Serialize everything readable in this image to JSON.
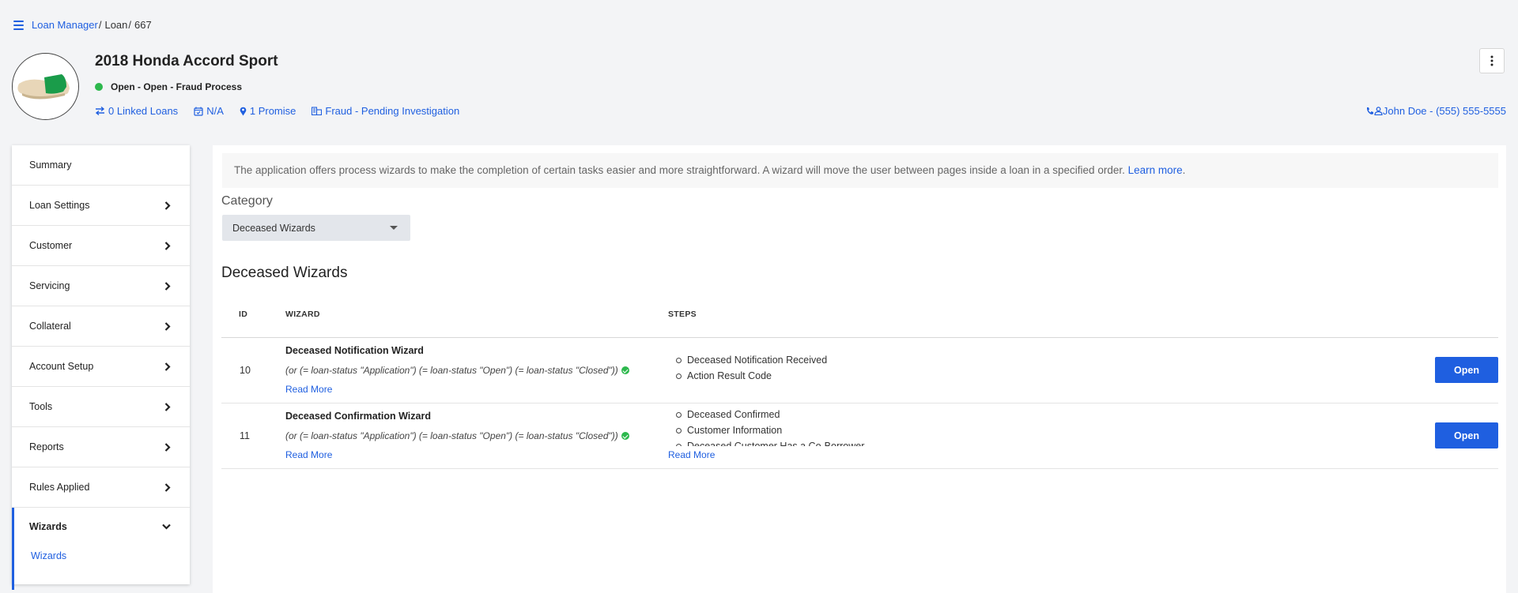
{
  "breadcrumb": {
    "items": [
      "Loan Manager",
      "Loan",
      "667"
    ],
    "separator": "/"
  },
  "header": {
    "title": "2018 Honda Accord Sport",
    "status": "Open - Open - Fraud Process",
    "status_color": "#2db84d",
    "linked_loans": "0 Linked Loans",
    "date": "N/A",
    "promise": "1 Promise",
    "portfolio": "Fraud - Pending Investigation",
    "contact": "John Doe - (555) 555-5555"
  },
  "sidebar": {
    "items": [
      {
        "label": "Summary",
        "chevron": false
      },
      {
        "label": "Loan Settings",
        "chevron": true
      },
      {
        "label": "Customer",
        "chevron": true
      },
      {
        "label": "Servicing",
        "chevron": true
      },
      {
        "label": "Collateral",
        "chevron": true
      },
      {
        "label": "Account Setup",
        "chevron": true
      },
      {
        "label": "Tools",
        "chevron": true
      },
      {
        "label": "Reports",
        "chevron": true
      },
      {
        "label": "Rules Applied",
        "chevron": true
      }
    ],
    "active": {
      "label": "Wizards",
      "sub": "Wizards"
    }
  },
  "main": {
    "info_text": "The application offers process wizards to make the completion of certain tasks easier and more straightforward. A wizard will move the user between pages inside a loan in a specified order.",
    "learn_more": "Learn more",
    "category_label": "Category",
    "category_value": "Deceased Wizards",
    "section_title": "Deceased Wizards",
    "columns": [
      "ID",
      "WIZARD",
      "STEPS"
    ],
    "rows": [
      {
        "id": "10",
        "name": "Deceased Notification Wizard",
        "condition": "(or (= loan-status \"Application\") (= loan-status \"Open\") (= loan-status \"Closed\"))",
        "read_more": "Read More",
        "steps": [
          "Deceased Notification Received",
          "Action Result Code"
        ],
        "steps_read_more": "",
        "button": "Open"
      },
      {
        "id": "11",
        "name": "Deceased Confirmation Wizard",
        "condition": "(or (= loan-status \"Application\") (= loan-status \"Open\") (= loan-status \"Closed\"))",
        "read_more": "Read More",
        "steps": [
          "Deceased Confirmed",
          "Customer Information",
          "Deceased Customer Has a Co-Borrower"
        ],
        "steps_read_more": "Read More",
        "button": "Open"
      }
    ]
  },
  "colors": {
    "accent": "#1f5fe0",
    "success": "#2db84d"
  }
}
